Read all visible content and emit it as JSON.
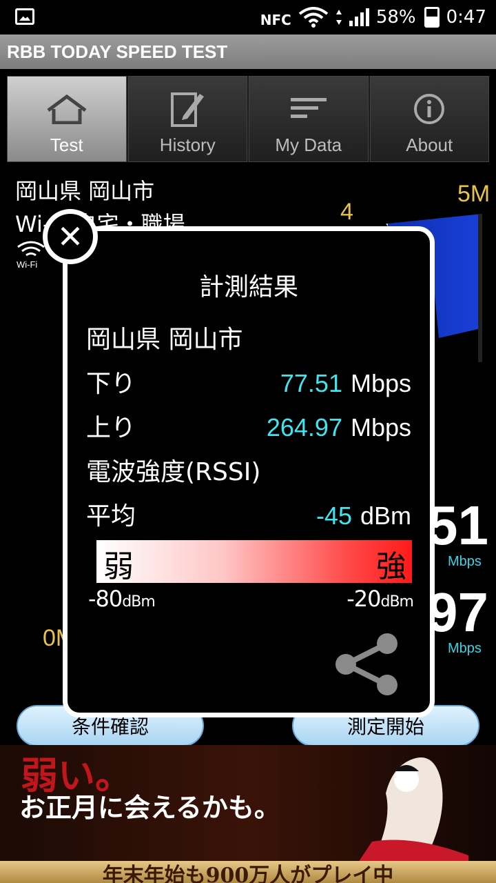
{
  "status_bar": {
    "nfc_label": "NFC",
    "battery": "58%",
    "time": "0:47"
  },
  "app": {
    "title": "RBB TODAY SPEED TEST"
  },
  "tabs": [
    {
      "label": "Test",
      "icon": "home-icon",
      "active": true
    },
    {
      "label": "History",
      "icon": "edit-icon",
      "active": false
    },
    {
      "label": "My Data",
      "icon": "list-icon",
      "active": false
    },
    {
      "label": "About",
      "icon": "info-icon",
      "active": false
    }
  ],
  "background": {
    "location": "岡山県 岡山市",
    "connection": "Wi-Fi 自宅・職場",
    "wifi_label": "Wi-Fi",
    "gauge_labels": [
      "4",
      "5M",
      "0M"
    ],
    "download_partial": "51",
    "upload_partial": "97",
    "unit": "Mbps",
    "buttons": {
      "check": "条件確認",
      "start": "測定開始"
    }
  },
  "modal": {
    "title": "計測結果",
    "location": "岡山県 岡山市",
    "download_label": "下り",
    "download_value": "77.51",
    "download_unit": "Mbps",
    "upload_label": "上り",
    "upload_value": "264.97",
    "upload_unit": "Mbps",
    "rssi_label": "電波強度(RSSI)",
    "avg_label": "平均",
    "avg_value": "-45",
    "avg_unit": "dBm",
    "bar_weak": "弱",
    "bar_strong": "強",
    "scale_min": "-80",
    "scale_max": "-20",
    "scale_unit": "dBm",
    "close_icon": "close-icon",
    "share_icon": "share-icon"
  },
  "ad": {
    "top_text": "弱い。",
    "line_text": "お正月に会えるかも。",
    "bottom_text": "年末年始も900万人がプレイ中"
  },
  "colors": {
    "accent_value": "#3ee6f2",
    "gauge_label": "#e8c24a",
    "button_bg": "#a9d5f2",
    "signal_strong": "#ff1a1a"
  }
}
